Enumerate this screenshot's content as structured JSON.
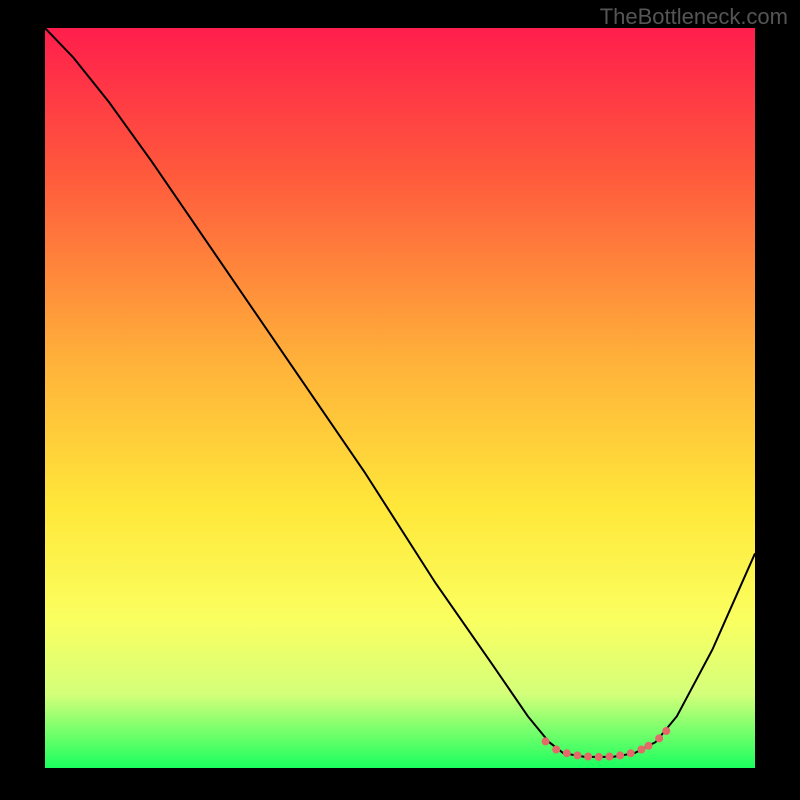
{
  "watermark": "TheBottleneck.com",
  "chart_data": {
    "type": "line",
    "title": "",
    "xlabel": "",
    "ylabel": "",
    "xlim": [
      0,
      100
    ],
    "ylim": [
      0,
      100
    ],
    "background_gradient": {
      "stops": [
        {
          "offset": 0,
          "color": "#ff1e4c"
        },
        {
          "offset": 20,
          "color": "#ff5a3c"
        },
        {
          "offset": 45,
          "color": "#ffb13a"
        },
        {
          "offset": 65,
          "color": "#ffe83a"
        },
        {
          "offset": 80,
          "color": "#faff60"
        },
        {
          "offset": 90,
          "color": "#d4ff7a"
        },
        {
          "offset": 100,
          "color": "#1aff5e"
        }
      ]
    },
    "series": [
      {
        "name": "bottleneck-curve",
        "color": "#000000",
        "width": 2,
        "points": [
          {
            "x": 0,
            "y": 100
          },
          {
            "x": 4,
            "y": 96
          },
          {
            "x": 9,
            "y": 90
          },
          {
            "x": 15,
            "y": 82
          },
          {
            "x": 25,
            "y": 68
          },
          {
            "x": 35,
            "y": 54
          },
          {
            "x": 45,
            "y": 40
          },
          {
            "x": 55,
            "y": 25
          },
          {
            "x": 63,
            "y": 14
          },
          {
            "x": 68,
            "y": 7
          },
          {
            "x": 71,
            "y": 3.5
          },
          {
            "x": 73,
            "y": 2
          },
          {
            "x": 76,
            "y": 1.5
          },
          {
            "x": 80,
            "y": 1.5
          },
          {
            "x": 83,
            "y": 2
          },
          {
            "x": 86,
            "y": 3.5
          },
          {
            "x": 89,
            "y": 7
          },
          {
            "x": 94,
            "y": 16
          },
          {
            "x": 100,
            "y": 29
          }
        ]
      }
    ],
    "markers": {
      "name": "optimal-zone",
      "color": "#e46a6a",
      "radius": 4,
      "points": [
        {
          "x": 70.5,
          "y": 3.6
        },
        {
          "x": 72.0,
          "y": 2.5
        },
        {
          "x": 73.5,
          "y": 2.0
        },
        {
          "x": 75.0,
          "y": 1.7
        },
        {
          "x": 76.5,
          "y": 1.55
        },
        {
          "x": 78.0,
          "y": 1.5
        },
        {
          "x": 79.5,
          "y": 1.55
        },
        {
          "x": 81.0,
          "y": 1.7
        },
        {
          "x": 82.5,
          "y": 2.0
        },
        {
          "x": 84.0,
          "y": 2.5
        },
        {
          "x": 85.0,
          "y": 3.0
        },
        {
          "x": 86.5,
          "y": 4.0
        },
        {
          "x": 87.5,
          "y": 5.0
        }
      ]
    }
  }
}
